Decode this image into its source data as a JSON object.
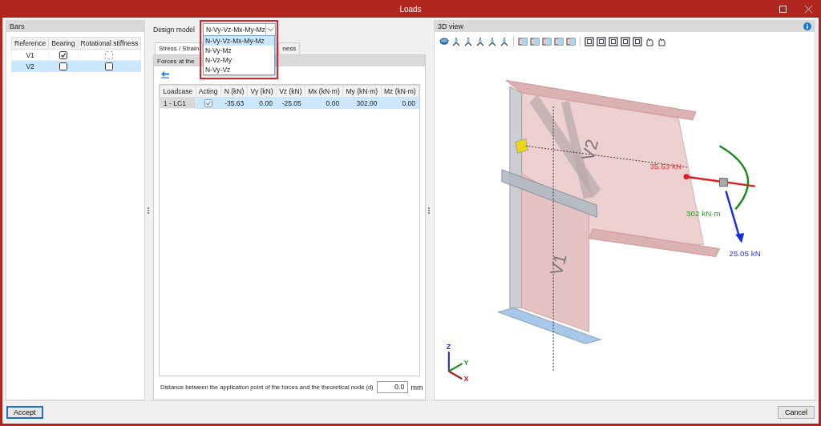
{
  "window": {
    "title": "Loads"
  },
  "bars": {
    "title": "Bars",
    "columns": [
      "Reference",
      "Bearing",
      "Rotational stiffness"
    ],
    "rows": [
      {
        "reference": "V1",
        "selected": false,
        "bearing": {
          "checked": true
        },
        "rotational_stiffness": {
          "checked": false,
          "disabled": true
        }
      },
      {
        "reference": "V2",
        "selected": true,
        "bearing": {
          "checked": false
        },
        "rotational_stiffness": {
          "checked": false,
          "disabled": false
        }
      }
    ]
  },
  "design_model": {
    "label": "Design model",
    "value": "N-Vy-Vz-Mx-My-Mz",
    "expanded": true,
    "options": [
      {
        "label": "N-Vy-Vz-Mx-My-Mz",
        "selected": true
      },
      {
        "label": "N-Vy-Mz",
        "selected": false
      },
      {
        "label": "N-Vz-My",
        "selected": false
      },
      {
        "label": "N-Vy-Vz",
        "selected": false
      }
    ]
  },
  "tabs": [
    {
      "label": "Stress / Strain",
      "selected": true
    },
    {
      "label": "ness",
      "selected": false
    }
  ],
  "forces": {
    "title": "Forces at the",
    "columns": [
      "Loadcase",
      "Acting",
      "N (kN)",
      "Vy (kN)",
      "Vz (kN)",
      "Mx (kN·m)",
      "My (kN·m)",
      "Mz (kN·m)"
    ],
    "rows": [
      {
        "selected": true,
        "loadcase": "1 - LC1",
        "acting": {
          "checked": true,
          "disabled": true
        },
        "values": [
          "-35.63",
          "0.00",
          "-25.05",
          "0.00",
          "302.00",
          "0.00"
        ]
      }
    ]
  },
  "distance": {
    "label": "Distance between the application point of the forces and the theoretical node (d)",
    "value": "0.0",
    "unit": "mm"
  },
  "view3d": {
    "title": "3D view",
    "labels": {
      "bar_1": "V1",
      "bar_2": "V2",
      "axial": "35.63 kN",
      "moment": "302 kN·m",
      "shear": "25.05 kN",
      "axis_z": "Z",
      "axis_y": "Y",
      "axis_x": "X"
    }
  },
  "buttons": {
    "accept": "Accept",
    "cancel": "Cancel"
  }
}
